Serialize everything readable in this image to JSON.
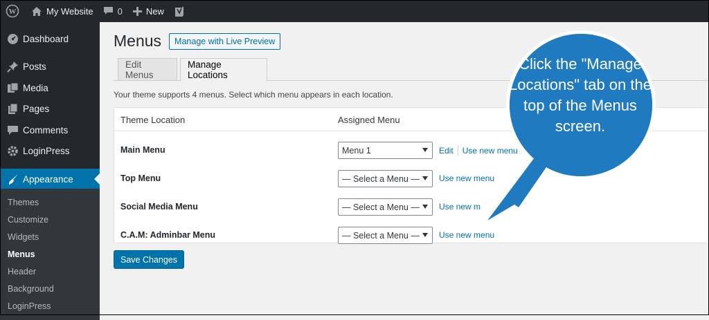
{
  "adminbar": {
    "site_name": "My Website",
    "comments_count": "0",
    "new_label": "New"
  },
  "sidebar": {
    "items": [
      {
        "label": "Dashboard",
        "icon": "dashboard-icon"
      },
      {
        "label": "Posts",
        "icon": "pin-icon"
      },
      {
        "label": "Media",
        "icon": "media-icon"
      },
      {
        "label": "Pages",
        "icon": "pages-icon"
      },
      {
        "label": "Comments",
        "icon": "comment-icon"
      },
      {
        "label": "LoginPress",
        "icon": "gear-icon"
      },
      {
        "label": "Appearance",
        "icon": "brush-icon"
      }
    ],
    "submenu": [
      "Themes",
      "Customize",
      "Widgets",
      "Menus",
      "Header",
      "Background",
      "LoginPress"
    ]
  },
  "main": {
    "title": "Menus",
    "preview_button": "Manage with Live Preview",
    "tabs": [
      "Edit Menus",
      "Manage Locations"
    ],
    "description": "Your theme supports 4 menus. Select which menu appears in each location.",
    "table": {
      "headers": [
        "Theme Location",
        "Assigned Menu"
      ],
      "rows": [
        {
          "location": "Main Menu",
          "menu": "Menu 1",
          "edit": "Edit",
          "use_new": "Use new menu"
        },
        {
          "location": "Top Menu",
          "menu": "— Select a Menu —",
          "use_new": "Use new menu"
        },
        {
          "location": "Social Media Menu",
          "menu": "— Select a Menu —",
          "use_new": "Use new m"
        },
        {
          "location": "C.A.M: Adminbar Menu",
          "menu": "— Select a Menu —",
          "use_new": "Use new menu"
        }
      ]
    },
    "save_button": "Save Changes"
  },
  "callout": {
    "text": "Click the \"Manage Locations\" tab on the top of the Menus screen."
  },
  "colors": {
    "admin_dark": "#23282d",
    "accent_blue": "#0073aa",
    "callout_blue": "#1f7ac0"
  }
}
